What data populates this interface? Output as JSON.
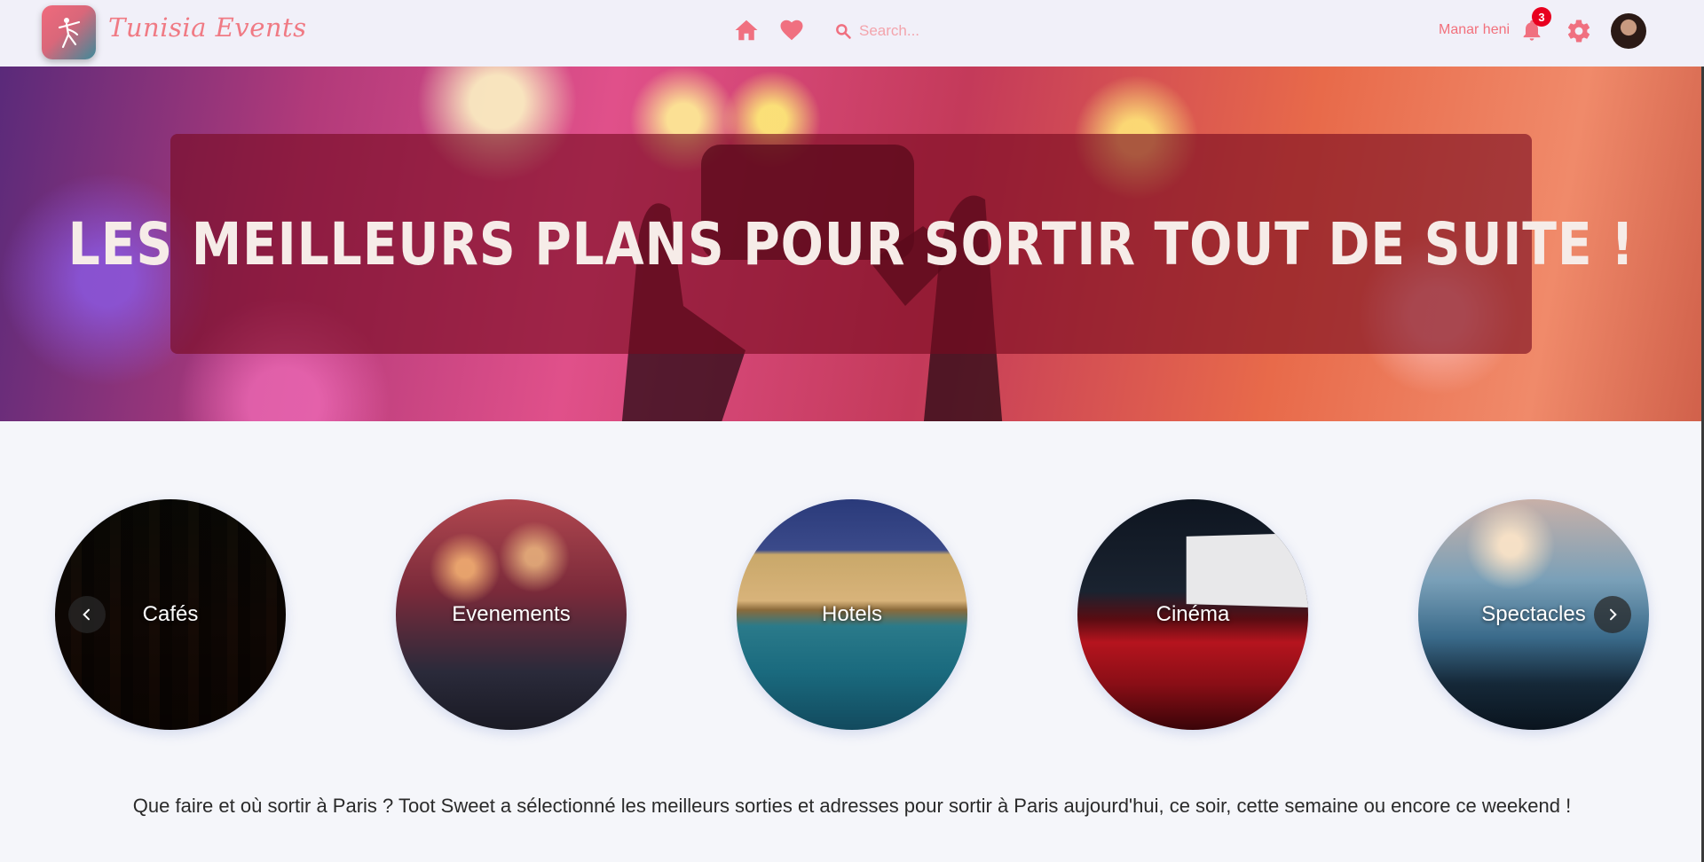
{
  "header": {
    "brand": "Tunisia Events",
    "nav": {
      "home_icon": "home-icon",
      "favorites_icon": "heart-icon"
    },
    "search": {
      "placeholder": "Search..."
    },
    "user_name": "Manar heni",
    "notifications_count": "3",
    "colors": {
      "accent": "#f2707c",
      "header_bg": "#f1f0f9",
      "badge": "#e8001f"
    }
  },
  "hero": {
    "title": "LES MEILLEURS PLANS POUR SORTIR TOUT DE SUITE !"
  },
  "categories": [
    {
      "label": "Cafés"
    },
    {
      "label": "Evenements"
    },
    {
      "label": "Hotels"
    },
    {
      "label": "Cinéma"
    },
    {
      "label": "Spectacles"
    }
  ],
  "intro_text": "Que faire et où sortir à Paris ? Toot Sweet a sélectionné les meilleurs sorties et adresses pour sortir à Paris aujourd'hui, ce soir, cette semaine ou encore ce weekend !"
}
